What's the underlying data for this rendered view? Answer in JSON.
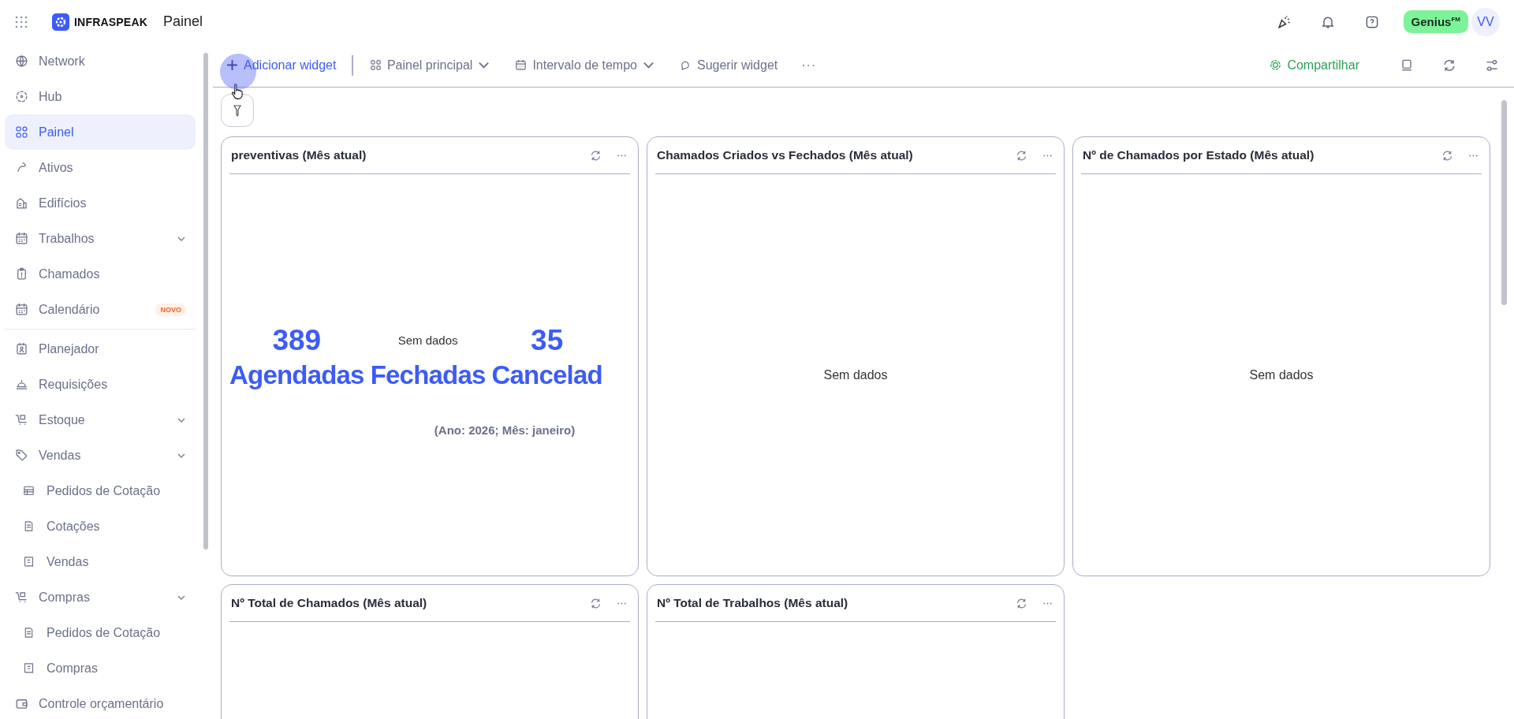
{
  "header": {
    "brand": "INFRASPEAK",
    "page_title": "Painel",
    "plan_badge": "Genius$^{FM}$",
    "avatar": "VV"
  },
  "sidebar": {
    "items": [
      {
        "label": "Network",
        "selected": false
      },
      {
        "label": "Hub",
        "selected": false
      },
      {
        "label": "Painel",
        "selected": true
      },
      {
        "label": "Ativos",
        "selected": false
      },
      {
        "label": "Edifícios",
        "selected": false
      },
      {
        "label": "Trabalhos",
        "selected": false,
        "submenu": true
      },
      {
        "label": "Chamados",
        "selected": false
      },
      {
        "label": "Calendário",
        "selected": false,
        "badge": "NOVO",
        "divider_after": true
      },
      {
        "label": "Planejador",
        "selected": false
      },
      {
        "label": "Requisições",
        "selected": false
      },
      {
        "label": "Estoque",
        "selected": false,
        "submenu": true
      },
      {
        "label": "Vendas",
        "selected": false,
        "submenu": true,
        "children": [
          {
            "label": "Pedidos de Cotação",
            "selected": false
          },
          {
            "label": "Cotações",
            "selected": false
          },
          {
            "label": "Vendas",
            "selected": false
          }
        ]
      },
      {
        "label": "Compras",
        "selected": false,
        "submenu": true,
        "children": [
          {
            "label": "Pedidos de Cotação",
            "selected": false
          },
          {
            "label": "Compras",
            "selected": false
          }
        ]
      },
      {
        "label": "Controle orçamentário",
        "selected": false
      }
    ]
  },
  "toolbar": {
    "add": "Adicionar widget",
    "dashboard": "Painel principal",
    "interval": "Intervalo de tempo",
    "suggest": "Sugerir widget",
    "more": "···",
    "share": "Compartilhar"
  },
  "widgets": [
    {
      "title": "preventivas (Mês atual)",
      "kind": "kpi",
      "metrics": [
        {
          "value": "389",
          "label": "Agendadas"
        },
        {
          "value": "Sem dados",
          "label": "Fechadas"
        },
        {
          "value": "35",
          "label": "Cancelad"
        }
      ],
      "subtitle": "(Ano: 2026; Mês: janeiro)"
    },
    {
      "title": "Chamados Criados vs Fechados (Mês atual)",
      "kind": "empty",
      "message": "Sem dados"
    },
    {
      "title": "Nº de Chamados por Estado (Mês atual)",
      "kind": "empty",
      "message": "Sem dados"
    },
    {
      "title": "Nº Total de Chamados (Mês atual)",
      "kind": "blank"
    },
    {
      "title": "Nº Total de Trabalhos (Mês atual)",
      "kind": "blank"
    }
  ]
}
